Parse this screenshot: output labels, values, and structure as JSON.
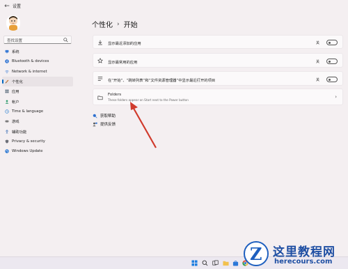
{
  "window": {
    "title": "设置",
    "back_icon": "back-arrow-icon"
  },
  "sidebar": {
    "search_placeholder": "查找设置",
    "items": [
      {
        "label": "系统",
        "icon": "system-icon",
        "color": "#3a7bd5",
        "active": false
      },
      {
        "label": "Bluetooth & devices",
        "icon": "bluetooth-icon",
        "color": "#2a6fd0",
        "active": false
      },
      {
        "label": "Network & internet",
        "icon": "network-icon",
        "color": "#4a86d8",
        "active": false
      },
      {
        "label": "个性化",
        "icon": "brush-icon",
        "color": "#c2742f",
        "active": true
      },
      {
        "label": "应用",
        "icon": "apps-icon",
        "color": "#5a6b7b",
        "active": false
      },
      {
        "label": "帐户",
        "icon": "account-icon",
        "color": "#2c9a6a",
        "active": false
      },
      {
        "label": "Time & language",
        "icon": "clock-globe-icon",
        "color": "#2a7fd0",
        "active": false
      },
      {
        "label": "游戏",
        "icon": "game-icon",
        "color": "#6a6a6a",
        "active": false
      },
      {
        "label": "辅助功能",
        "icon": "accessibility-icon",
        "color": "#3b6fb5",
        "active": false
      },
      {
        "label": "Privacy & security",
        "icon": "shield-icon",
        "color": "#6c6f78",
        "active": false
      },
      {
        "label": "Windows Update",
        "icon": "update-icon",
        "color": "#1f6fcf",
        "active": false
      }
    ]
  },
  "main": {
    "breadcrumb_parent": "个性化",
    "breadcrumb_sep": "›",
    "breadcrumb_current": "开始",
    "rows": [
      {
        "label": "显示最近添加的应用",
        "icon": "download-icon",
        "toggle_label": "关"
      },
      {
        "label": "显示最常用的应用",
        "icon": "star-icon",
        "toggle_label": "关"
      },
      {
        "label": "在“开始”、“跳转列表”和“文件资源管理器”中显示最近打开的项目",
        "icon": "list-icon",
        "toggle_label": "关"
      }
    ],
    "folders": {
      "label": "Folders",
      "sublabel": "These folders appear on Start next to the Power button",
      "icon": "folder-icon"
    },
    "links": [
      {
        "label": "获取帮助",
        "icon": "help-icon"
      },
      {
        "label": "提供反馈",
        "icon": "feedback-icon"
      }
    ]
  },
  "taskbar": {
    "icons": [
      "windows-start-icon",
      "search-taskbar-icon",
      "task-view-icon",
      "folder-taskbar-icon",
      "store-taskbar-icon",
      "chrome-taskbar-icon"
    ]
  },
  "watermark": {
    "letter": "Z",
    "title": "这里教程网",
    "url": "herecours.com"
  },
  "colors": {
    "accent": "#0067c0",
    "arrow": "#d03a2c"
  }
}
